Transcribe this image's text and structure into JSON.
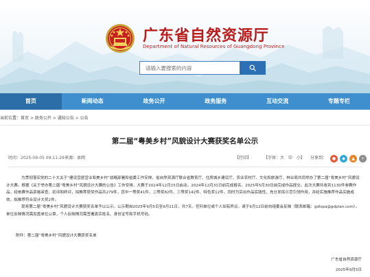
{
  "header": {
    "site_title": "广东省自然资源厅",
    "site_subtitle": "Department of Natural Resources of Guangdong Province",
    "search_placeholder": "请输入要搜索的内容"
  },
  "nav": {
    "items": [
      "首页",
      "新闻动态",
      "政务公开",
      "政务服务",
      "互动交流",
      "专题专栏"
    ],
    "active_index": 0
  },
  "breadcrumb": {
    "prefix": "当前位置：",
    "items": [
      "首页",
      "政务公开",
      "通知公告",
      "公告"
    ],
    "separator": " > "
  },
  "article": {
    "title": "第二届“粤美乡村”风貌设计大赛获奖名单公示",
    "time": "时间：2025-09-05 09:11:29",
    "source": "来源：本网",
    "print": "【打印】",
    "font_size": "【字体：大　中　小】",
    "share": "分享到：",
    "paragraphs": [
      "为贯彻落实党的二十大关于“建设宜居宜业和美乡村”战略部署和省委工作安排，省自然资源厅联合省教育厅、住房城乡建设厅、农业农村厅、文化和旅游厅、林业局共同举办了第二届“粤美乡村”风貌设计大赛。根据《关于举办第二届“粤美乡村”风貌设计大赛的公告》工作安排，大赛于2024年12月15日启动，2024年12月31日前完成报名，2025年5月30日前完成作品提交。此次大赛共收到1130件参赛作品，经参赛作品资格审查、初评和终评，拟推荐获奖作品共279件，其中一等奖41件、二等奖82件、三等奖142件、特色奖12件，同时为突出作品实践性，充分发挥示范引领作用，并经实施推荐作品实施成效，拟推荐符合设计大奖2件。",
      "现将第二届“粤美乡村”风貌设计大赛获奖名单予以公示。公示期自2025年9月5日至9月11日，共7天。任何单位或个人如有异议，请于9月12日前向组委会反映（联系邮箱：gdlspa@gdplan.com）。单位反映情况需加盖单位公章，个人反映情况需签署真实姓名、身份证号和手机号码。"
    ],
    "attachment": "附件：第二届“粤美乡村”风貌设计大赛获奖名单",
    "sign_org": "广东省自然资源厅",
    "sign_date": "2025年9月5日"
  },
  "colors": {
    "brand_red": "#b91c1c",
    "nav_blue": "#3f8fcf",
    "nav_active": "#2c6ea8",
    "search_btn": "#2d6fb4"
  },
  "icons": {
    "search": "search-icon",
    "emblem": "national-emblem-icon",
    "share": [
      "share-wechat-icon",
      "share-weibo-icon",
      "share-qq-icon",
      "share-more-icon"
    ]
  }
}
